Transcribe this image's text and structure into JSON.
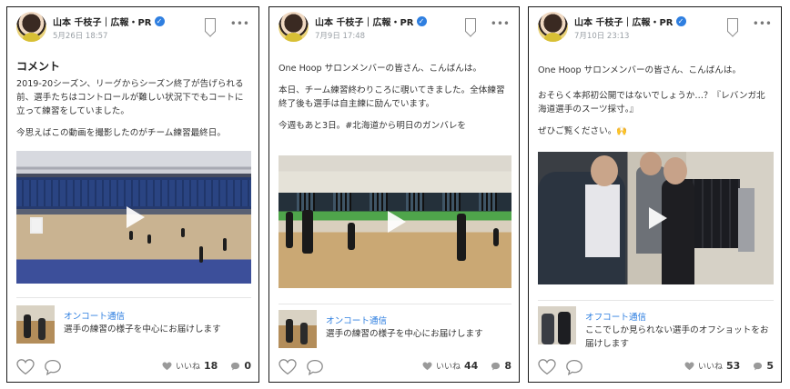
{
  "posts": [
    {
      "author": "山本 千枝子｜広報・PR",
      "verified_mark": "✓",
      "date": "5月26日 18:57",
      "title": "コメント",
      "paragraphs": [
        "2019-20シーズン、リーグからシーズン終了が告げられる前、選手たちはコントロールが難しい状況下でもコートに立って練習をしていました。",
        "今思えばこの動画を撮影したのがチーム練習最終日。"
      ],
      "media": "video",
      "related_title": "オンコート通信",
      "related_desc": "選手の練習の様子を中心にお届けします",
      "like_label": "いいね",
      "likes": "18",
      "comments": "0"
    },
    {
      "author": "山本 千枝子｜広報・PR",
      "verified_mark": "✓",
      "date": "7月9日 17:48",
      "title": "",
      "paragraphs": [
        "One Hoop サロンメンバーの皆さん、こんばんは。",
        "本日、チーム練習終わりころに覗いてきました。全体練習終了後も選手は自主練に励んでいます。",
        "今週もあと3日。#北海道から明日のガンバレを"
      ],
      "media": "video",
      "related_title": "オンコート通信",
      "related_desc": "選手の練習の様子を中心にお届けします",
      "like_label": "いいね",
      "likes": "44",
      "comments": "8"
    },
    {
      "author": "山本 千枝子｜広報・PR",
      "verified_mark": "✓",
      "date": "7月10日 23:13",
      "title": "",
      "paragraphs": [
        "One Hoop サロンメンバーの皆さん、こんばんは。",
        "おそらく本邦初公開ではないでしょうか…？『レバンガ北海道選手のスーツ採寸。』",
        "ぜひご覧ください。🙌"
      ],
      "media": "video",
      "related_title": "オフコート通信",
      "related_desc": "ここでしか見られない選手のオフショットをお届けします",
      "like_label": "いいね",
      "likes": "53",
      "comments": "5"
    }
  ],
  "colors": {
    "accent": "#2f7fe0",
    "muted": "#9aa0a6",
    "border": "#1a1a1a"
  }
}
